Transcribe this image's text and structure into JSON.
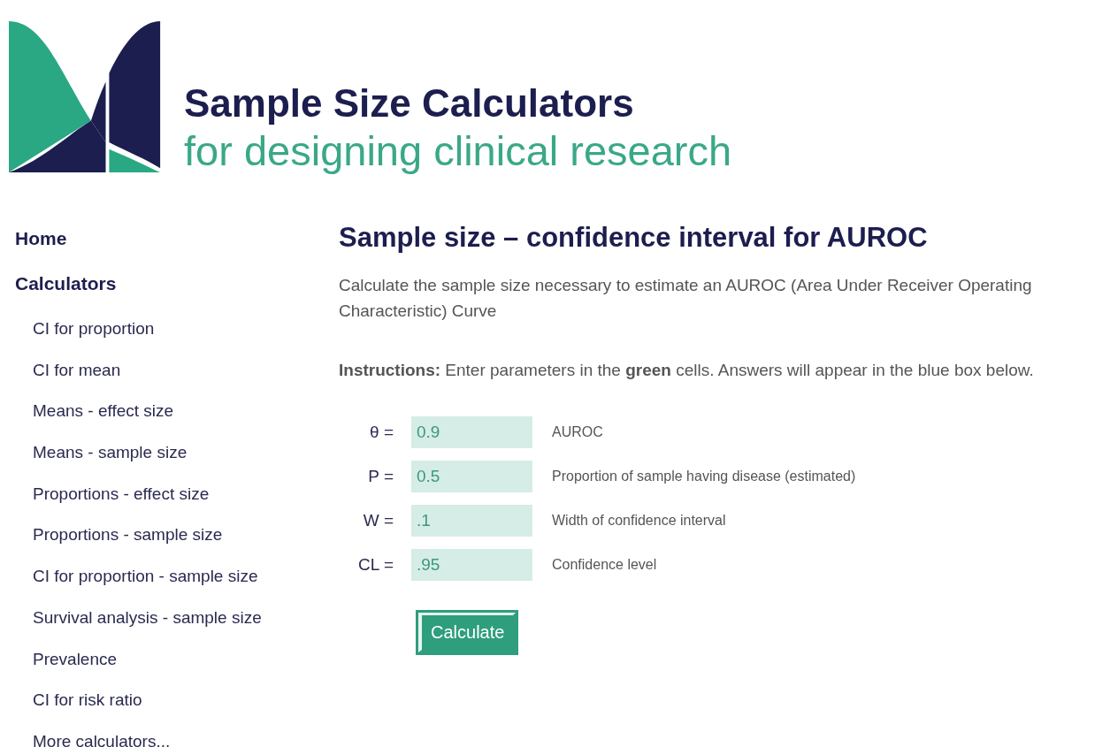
{
  "header": {
    "title": "Sample Size Calculators",
    "subtitle": "for designing clinical research"
  },
  "sidebar": {
    "sections": [
      {
        "label": "Home"
      },
      {
        "label": "Calculators",
        "items": [
          "CI for proportion",
          "CI for mean",
          "Means - effect size",
          "Means - sample size",
          "Proportions - effect size",
          "Proportions - sample size",
          "CI for proportion - sample size",
          "Survival analysis - sample size",
          "Prevalence",
          "CI for risk ratio",
          "More calculators..."
        ]
      }
    ]
  },
  "main": {
    "heading": "Sample size – confidence interval for AUROC",
    "description": "Calculate the sample size necessary to estimate an AUROC (Area Under Receiver Operating Characteristic) Curve",
    "instructions": "**Instructions:** Enter parameters in the **green** cells. Answers will appear in the blue box below.",
    "fields": [
      {
        "symbol": "θ =",
        "value": "0.9",
        "description": "AUROC"
      },
      {
        "symbol": "P =",
        "value": "0.5",
        "description": "Proportion of sample having disease (estimated)"
      },
      {
        "symbol": "W =",
        "value": ".1",
        "description": "Width of confidence interval"
      },
      {
        "symbol": "CL =",
        "value": ".95",
        "description": "Confidence level"
      }
    ],
    "button": "Calculate"
  }
}
